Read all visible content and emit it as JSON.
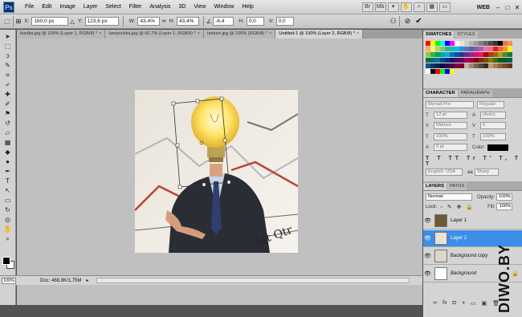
{
  "menubar": {
    "logo": "Ps",
    "items": [
      "File",
      "Edit",
      "Image",
      "Layer",
      "Select",
      "Filter",
      "Analysis",
      "3D",
      "View",
      "Window",
      "Help"
    ],
    "workspace": "WEB",
    "window_controls": [
      "–",
      "□",
      "✕"
    ]
  },
  "options": {
    "x_label": "X:",
    "x": "160,0 px",
    "y_label": "Y:",
    "y": "123,6 px",
    "w_label": "W:",
    "w": "43,4%",
    "h_label": "H:",
    "h": "43,4%",
    "angle": "-6,4",
    "hskew_label": "H:",
    "hskew": "0,0",
    "vskew_label": "V:",
    "vskew": "0,0"
  },
  "tabs": [
    {
      "label": "ibadka.jpg @ 100% (Layer 1, RGB/8) *"
    },
    {
      "label": "lampochka.jpg @ 66,7% (Layer 1, RGB/8) *"
    },
    {
      "label": "texture.jpg @ 100% (RGB/8) *"
    },
    {
      "label": "Untitled-1 @ 100% (Layer 2, RGB/8) *"
    }
  ],
  "status": {
    "zoom": "100%",
    "doc": "Doc: 468,8K/1,75M"
  },
  "swatches": {
    "tabs": [
      "SWATCHES",
      "STYLES"
    ],
    "colors": [
      "#ff0000",
      "#ffff00",
      "#00ff00",
      "#00ffff",
      "#0000ff",
      "#ff00ff",
      "#ffffff",
      "#e6e6e6",
      "#cccccc",
      "#b3b3b3",
      "#999999",
      "#808080",
      "#666666",
      "#4d4d4d",
      "#333333",
      "#000000",
      "#f26c4f",
      "#f68e55",
      "#fbaf5c",
      "#fff467",
      "#acd372",
      "#7cc576",
      "#3bb878",
      "#1abbb4",
      "#00bff3",
      "#438cca",
      "#5574b9",
      "#605ca8",
      "#855fa8",
      "#a763a8",
      "#f06ea9",
      "#f26d7d",
      "#ed1c24",
      "#f26522",
      "#f7941d",
      "#fff200",
      "#8dc73f",
      "#39b54a",
      "#00a651",
      "#00a99d",
      "#00aeef",
      "#0072bc",
      "#0054a6",
      "#2e3192",
      "#662d91",
      "#92278f",
      "#ec008c",
      "#ed145b",
      "#9e0b0f",
      "#a0410d",
      "#a3620a",
      "#aba000",
      "#598527",
      "#197b30",
      "#007236",
      "#00746b",
      "#0076a3",
      "#004b80",
      "#003471",
      "#1b1464",
      "#440e62",
      "#630460",
      "#9e005d",
      "#9e0039",
      "#790000",
      "#7b2e00",
      "#7d4900",
      "#827b00",
      "#406618",
      "#005e20",
      "#005826",
      "#005952",
      "#005b7f",
      "#003663",
      "#002157",
      "#0d004c",
      "#32004b",
      "#4b0049",
      "#7b0046",
      "#7a0026",
      "#c7b299",
      "#998675",
      "#736357",
      "#534741",
      "#37302a",
      "#c69c6d",
      "#a67c52",
      "#8c6239",
      "#754c24",
      "#603913",
      "#ffffff",
      "#000000",
      "#ff0000",
      "#00ff00",
      "#0000ff",
      "#ffff00"
    ]
  },
  "character": {
    "tabs": [
      "CHARACTER",
      "PARAGRAPH"
    ],
    "font": "Myriad Pro",
    "style": "Regular",
    "size": "12 pt",
    "leading": "(Auto)",
    "kerning": "Metrics",
    "tracking": "0",
    "vscale": "100%",
    "hscale": "100%",
    "baseline": "0 pt",
    "color_label": "Color:",
    "language": "English: USA",
    "aa": "Sharp",
    "aa_prefix": "aa"
  },
  "layers": {
    "tabs": [
      "LAYERS",
      "PATHS"
    ],
    "blend": "Normal",
    "opacity_label": "Opacity:",
    "opacity": "100%",
    "lock_label": "Lock:",
    "fill_label": "Fill:",
    "fill": "100%",
    "items": [
      {
        "name": "Layer 1"
      },
      {
        "name": "Layer 2"
      },
      {
        "name": "Background copy"
      },
      {
        "name": "Background"
      }
    ]
  },
  "watermark": "DIWO.BY"
}
